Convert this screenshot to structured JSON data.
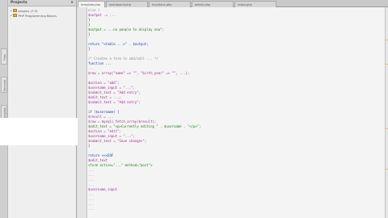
{
  "left_strip": {
    "tabs": [
      "Files",
      "Services",
      "Navigator"
    ]
  },
  "projects": {
    "header": "Projects",
    "items": [
      {
        "label": "plugins (7.0)",
        "indent": 0
      },
      {
        "label": "PHP Programming Basics",
        "indent": 0
      }
    ]
  },
  "tabs": [
    {
      "label": "template.php",
      "active": true
    },
    {
      "label": "dashboard.php",
      "active": false
    },
    {
      "label": "functions.php",
      "active": false
    },
    {
      "label": "admin.php",
      "active": false
    },
    {
      "label": "index.php",
      "active": false
    }
  ],
  "code_lines": [
    {
      "n": "",
      "text": "            else {",
      "cls": "cm"
    },
    {
      "n": "",
      "text": "                $output .= ...",
      "cls": "var"
    },
    {
      "n": "",
      "text": "            }",
      "cls": ""
    },
    {
      "n": "",
      "text": "        }",
      "cls": ""
    },
    {
      "n": "",
      "text": "        $output = ...no people to display now\";",
      "cls": "str"
    },
    {
      "n": "",
      "text": "    }",
      "cls": ""
    },
    {
      "n": "",
      "text": "",
      "cls": ""
    },
    {
      "n": "",
      "text": "    return \"<table ...>\" . $output;",
      "cls": "kw"
    },
    {
      "n": "",
      "text": "}",
      "cls": ""
    },
    {
      "n": "",
      "text": "",
      "cls": ""
    },
    {
      "n": "",
      "text": "/* Creates a form to add/edit ... */",
      "cls": "cm"
    },
    {
      "n": "",
      "text": "function ...",
      "cls": "kw"
    },
    {
      "n": "",
      "text": "    ...",
      "cls": "cm"
    },
    {
      "n": "",
      "text": "    $row = array(\"name\" => \"\", \"birth_year\" => \"\", ...);",
      "cls": "var"
    },
    {
      "n": "",
      "text": "",
      "cls": ""
    },
    {
      "n": "",
      "text": "    $action = \"add\";",
      "cls": "var"
    },
    {
      "n": "",
      "text": "    $username_input = \"...\";",
      "cls": "var"
    },
    {
      "n": "",
      "text": "    $submit_text = \"Add entry\";",
      "cls": "var"
    },
    {
      "n": "",
      "text": "    $edit_text = ...;",
      "cls": "var"
    },
    {
      "n": "",
      "text": "    $submit_text = \"Add entry\";",
      "cls": "var"
    },
    {
      "n": "",
      "text": "",
      "cls": ""
    },
    {
      "n": "",
      "text": "    if ($username) {",
      "cls": "kw"
    },
    {
      "n": "",
      "text": "        $result = ...",
      "cls": "var"
    },
    {
      "n": "",
      "text": "        $row = mysqli_fetch_array($result);",
      "cls": "var"
    },
    {
      "n": "",
      "text": "        $edit_text = \"<p>Currently editing \" . $username . \"</p>\";",
      "cls": "str"
    },
    {
      "n": "",
      "text": "        $action = \"edit\";",
      "cls": "var"
    },
    {
      "n": "",
      "text": "        $username_input = \"...\";",
      "cls": "var"
    },
    {
      "n": "",
      "text": "        $submit_text = \"Save changes\";",
      "cls": "var"
    },
    {
      "n": "",
      "text": "    }",
      "cls": ""
    },
    {
      "n": "",
      "text": "",
      "cls": ""
    },
    {
      "n": "",
      "text": "    return <<<EOF",
      "cls": "kw"
    },
    {
      "n": "",
      "text": "        $edit_text",
      "cls": "var"
    },
    {
      "n": "",
      "text": "        <form action=\"...\" method=\"post\">",
      "cls": "str"
    },
    {
      "n": "",
      "text": "            ...",
      "cls": "cm"
    },
    {
      "n": "",
      "text": "            ...",
      "cls": "cm"
    },
    {
      "n": "",
      "text": "            ...",
      "cls": "cm"
    },
    {
      "n": "",
      "text": "            ...",
      "cls": "cm"
    },
    {
      "n": "",
      "text": "            $username_input",
      "cls": "var"
    },
    {
      "n": "",
      "text": "            ...",
      "cls": "cm"
    },
    {
      "n": "",
      "text": "            ...",
      "cls": "cm"
    },
    {
      "n": "",
      "text": "            ...",
      "cls": "cm"
    },
    {
      "n": "",
      "text": "            ...",
      "cls": "cm"
    }
  ],
  "highlight_line_numbers": [
    "72",
    "73",
    "74",
    "75",
    "76",
    "77"
  ]
}
